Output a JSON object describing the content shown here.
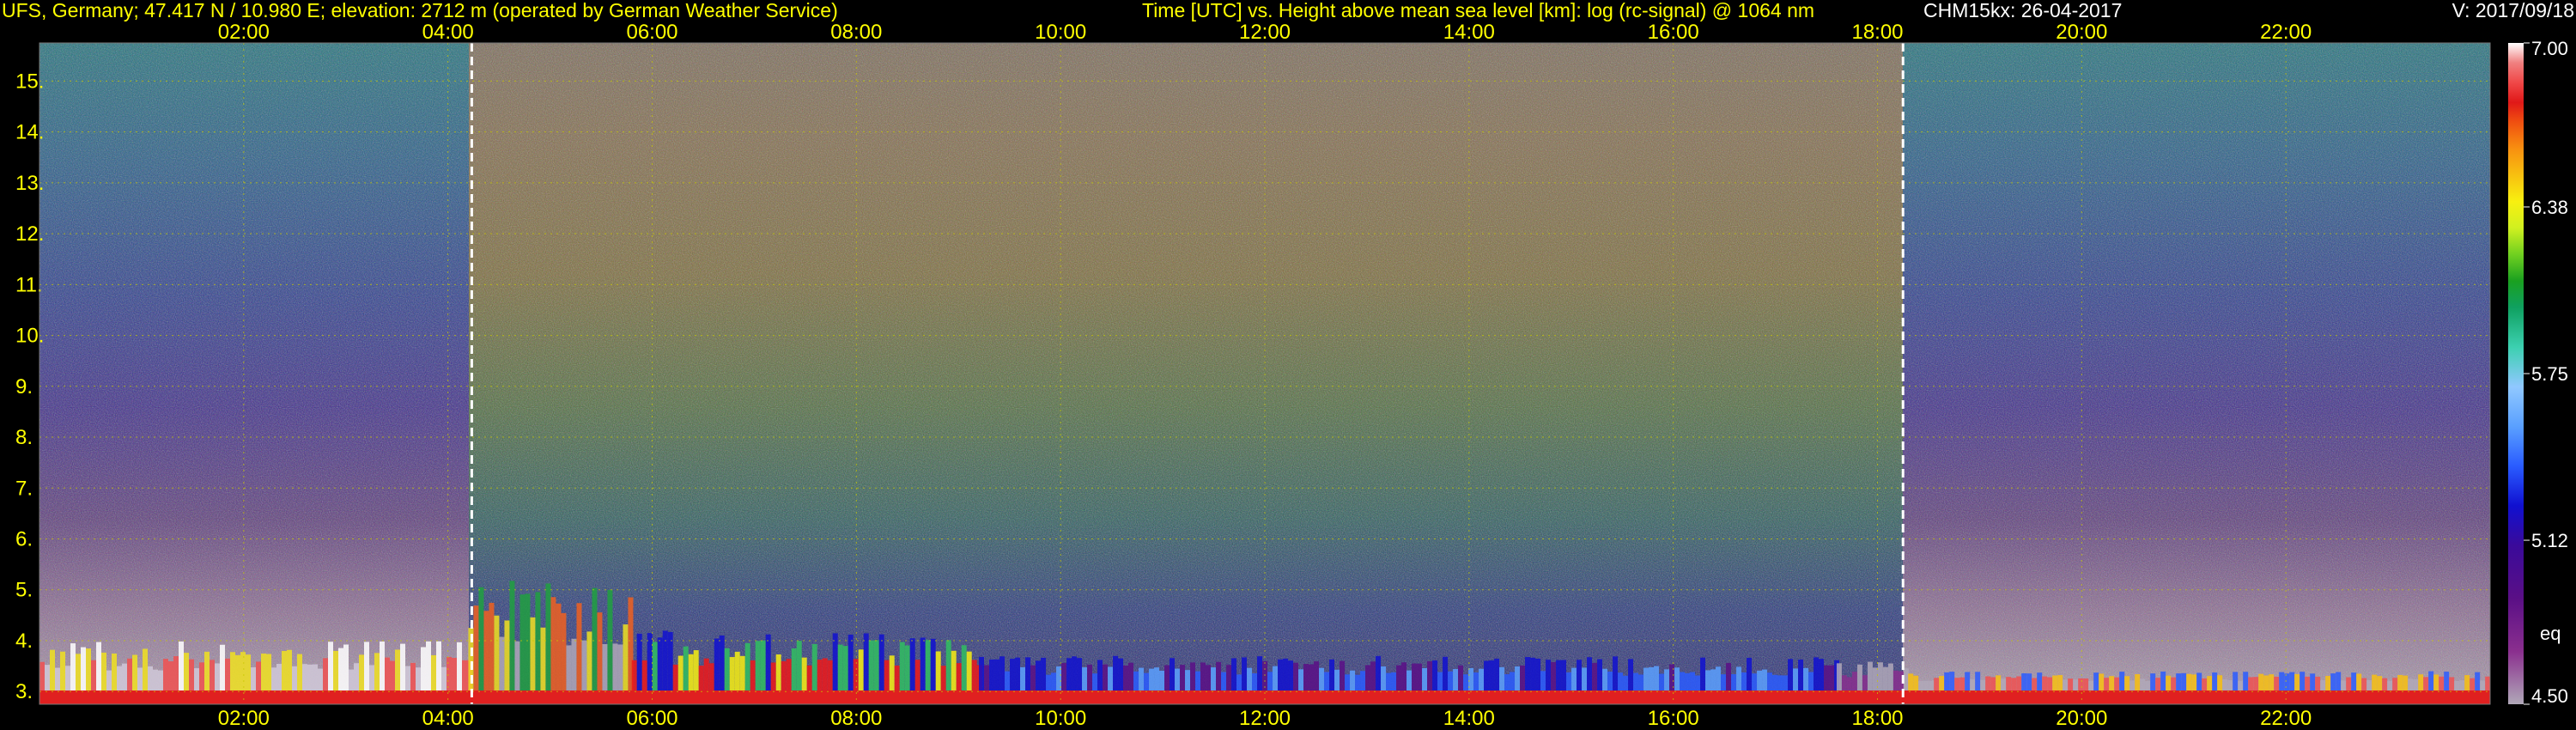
{
  "header": {
    "station": "UFS, Germany; 47.417 N / 10.980 E; elevation: 2712 m  (operated by German Weather Service)",
    "description": "Time [UTC] vs. Height above mean sea level [km]: log (rc-signal) @ 1064 nm",
    "instrument": "CHM15kx: 26-04-2017",
    "version": "V: 2017/09/18"
  },
  "colorbar": {
    "ticks": [
      "7.00",
      "6.38",
      "5.75",
      "5.12",
      "4.50"
    ],
    "unit_label": "eq",
    "range": [
      4.5,
      7.0
    ],
    "colors": [
      "#b0a8b8",
      "#8a2f8e",
      "#5a0f86",
      "#3a0a9a",
      "#1010d0",
      "#2a5cff",
      "#5aa0ff",
      "#90c8ff",
      "#3cd0b0",
      "#0fa060",
      "#1aa020",
      "#70d020",
      "#d0f020",
      "#f8f010",
      "#f8c010",
      "#f89010",
      "#f05010",
      "#e01818",
      "#f04848",
      "#f08080",
      "#ffffff"
    ]
  },
  "chart_data": {
    "type": "heatmap",
    "title": "Time [UTC] vs. Height above mean sea level [km]: log (rc-signal) @ 1064 nm",
    "xlabel": "Time [UTC]",
    "ylabel": "Height above mean sea level [km]",
    "x_ticks": [
      "02:00",
      "04:00",
      "06:00",
      "08:00",
      "10:00",
      "12:00",
      "14:00",
      "16:00",
      "18:00",
      "20:00",
      "22:00"
    ],
    "x_range_hours": [
      0,
      24
    ],
    "y_ticks": [
      "3.",
      "4.",
      "5.",
      "6.",
      "7.",
      "8.",
      "9.",
      "10.",
      "11.",
      "12.",
      "13.",
      "14.",
      "15."
    ],
    "y_range_km": [
      2.75,
      15.75
    ],
    "color_scale_range": [
      4.5,
      7.0
    ],
    "sunrise_utc": "04:14",
    "sunset_utc": "18:15",
    "grid": true
  }
}
